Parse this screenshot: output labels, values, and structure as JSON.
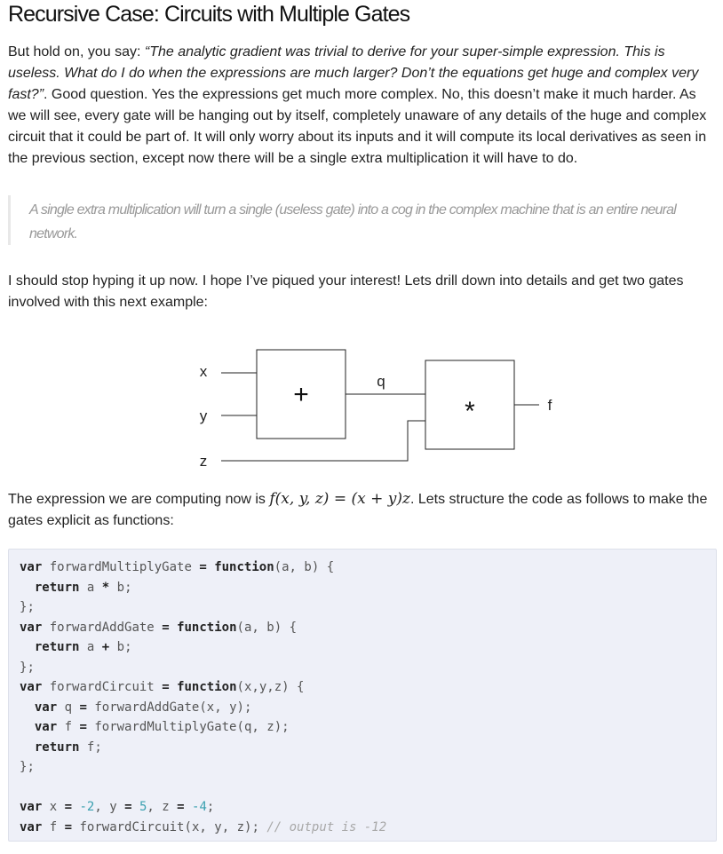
{
  "heading": "Recursive Case: Circuits with Multiple Gates",
  "para1": {
    "lead": "But hold on, you say: ",
    "quote": "“The analytic gradient was trivial to derive for your super-simple expression. This is useless. What do I do when the expressions are much larger? Don’t the equations get huge and complex very fast?”",
    "rest": ". Good question. Yes the expressions get much more complex. No, this doesn’t make it much harder. As we will see, every gate will be hanging out by itself, completely unaware of any details of the huge and complex circuit that it could be part of. It will only worry about its inputs and it will compute its local derivatives as seen in the previous section, except now there will be a single extra multiplication it will have to do."
  },
  "blockquote": "A single extra multiplication will turn a single (useless gate) into a cog in the complex machine that is an entire neural network.",
  "para2": "I should stop hyping it up now. I hope I’ve piqued your interest! Lets drill down into details and get two gates involved with this next example:",
  "diagram": {
    "input_x": "x",
    "input_y": "y",
    "input_z": "z",
    "add_gate": "+",
    "wire_q": "q",
    "mul_gate": "*",
    "output_f": "f"
  },
  "para3": {
    "lead": "The expression we are computing now is ",
    "formula": "f(x, y, z) = (x + y)z",
    "rest": ". Lets structure the code as follows to make the gates explicit as functions:"
  },
  "code": {
    "lines": [
      "var forwardMultiplyGate = function(a, b) {",
      "  return a * b;",
      "};",
      "var forwardAddGate = function(a, b) {",
      "  return a + b;",
      "};",
      "var forwardCircuit = function(x,y,z) {",
      "  var q = forwardAddGate(x, y);",
      "  var f = forwardMultiplyGate(q, z);",
      "  return f;",
      "};",
      "",
      "var x = -2, y = 5, z = -4;",
      "var f = forwardCircuit(x, y, z); // output is -12"
    ]
  }
}
